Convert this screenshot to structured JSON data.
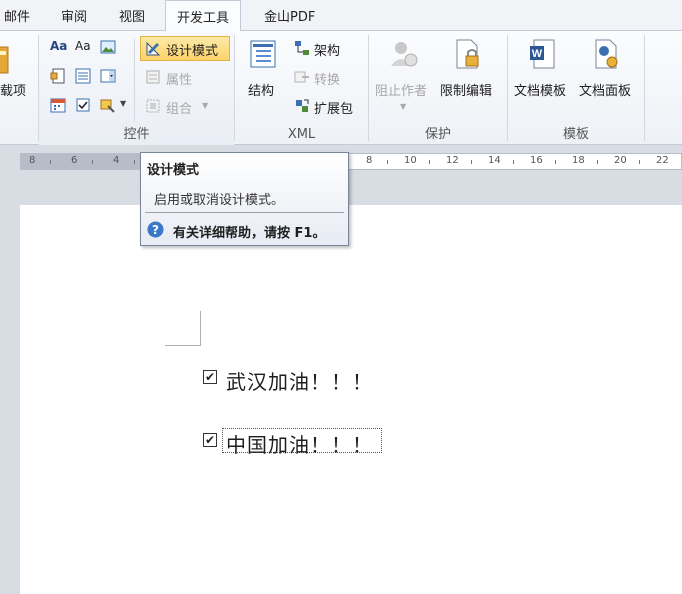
{
  "tabs": [
    "邮件",
    "审阅",
    "视图",
    "开发工具",
    "金山PDF"
  ],
  "active_tab_index": 3,
  "ribbon": {
    "addins_label_partial": "载项",
    "controls": {
      "group_label": "控件",
      "design_mode": "设计模式",
      "properties": "属性",
      "group": "组合"
    },
    "xml": {
      "group_label": "XML",
      "structure": "结构",
      "schema": "架构",
      "transform": "转换",
      "expansion_pack": "扩展包"
    },
    "protect": {
      "group_label": "保护",
      "block_authors": "阻止作者",
      "restrict_editing": "限制编辑"
    },
    "templates": {
      "group_label": "模板",
      "document_template": "文档模板",
      "document_panel": "文档面板"
    }
  },
  "ruler": {
    "ticks_left": [
      "8",
      "6",
      "4"
    ],
    "ticks_right": [
      "8",
      "10",
      "12",
      "14",
      "16",
      "18",
      "20",
      "22"
    ]
  },
  "tooltip": {
    "title": "设计模式",
    "description": "启用或取消设计模式。",
    "help_text": "有关详细帮助，请按 F1。"
  },
  "document": {
    "lines": [
      {
        "checked": true,
        "text": "武汉加油！！！"
      },
      {
        "checked": true,
        "text": "中国加油！！！"
      }
    ]
  },
  "colors": {
    "accent": "#fbd36b",
    "help_icon": "#3a78c9"
  }
}
